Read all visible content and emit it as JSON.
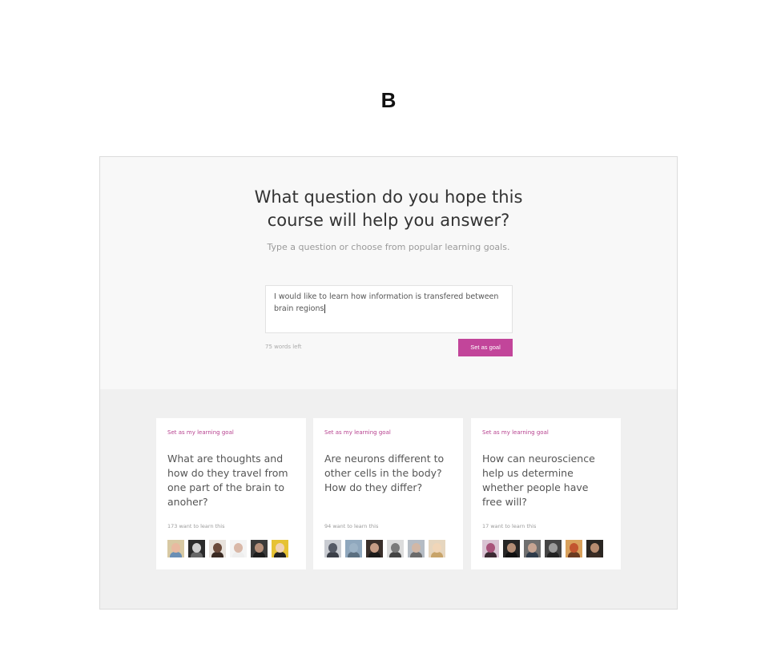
{
  "figure_label": "B",
  "page": {
    "title_lines": [
      "What question do you hope this",
      "course will help you answer?"
    ],
    "subtitle": "Type a question or choose from popular learning goals."
  },
  "goal_input": {
    "lines": [
      "I would like to learn how information is transfered between",
      "brain regions"
    ],
    "words_left": "75 words left",
    "button_label": "Set as goal"
  },
  "cards": [
    {
      "link_label": "Set as my learning goal",
      "question": "What are thoughts and how do they travel from one part of the brain to anoher?",
      "count_label": "173 want to learn this",
      "avatars": [
        {
          "bg": "#d8c9a3",
          "face": "#e9b9a0",
          "body": "#6a8fb5"
        },
        {
          "bg": "#2b2b2b",
          "face": "#cfcfcf",
          "body": "#666666"
        },
        {
          "bg": "#e8e2dc",
          "face": "#6b4a3a",
          "body": "#3a2a22"
        },
        {
          "bg": "#f4f4f4",
          "face": "#d9b8a8",
          "body": "#eeeeee"
        },
        {
          "bg": "#3a3a3a",
          "face": "#b58f7a",
          "body": "#1c1c1c"
        },
        {
          "bg": "#e6c234",
          "face": "#f0d3b5",
          "body": "#222222"
        }
      ]
    },
    {
      "link_label": "Set as my learning goal",
      "question": "Are neurons different  to other cells in the body? How do they differ?",
      "count_label": "94 want to learn this",
      "avatars": [
        {
          "bg": "#c9ccd2",
          "face": "#555a66",
          "body": "#3b3f48"
        },
        {
          "bg": "#8fa7bd",
          "face": "#9db3c6",
          "body": "#5b6f80"
        },
        {
          "bg": "#3a2f2a",
          "face": "#c79d86",
          "body": "#1a1a1a"
        },
        {
          "bg": "#dcdcdc",
          "face": "#7a7a7a",
          "body": "#444444"
        },
        {
          "bg": "#b5bcc4",
          "face": "#d2b7a5",
          "body": "#6b6b6b"
        },
        {
          "bg": "#e6d6bf",
          "face": "#f1d6b8",
          "body": "#c8a46a"
        }
      ]
    },
    {
      "link_label": "Set as my learning goal",
      "question": "How can neuroscience help us determine whether people have free will?",
      "count_label": "17 want to learn this",
      "avatars": [
        {
          "bg": "#d9c3d3",
          "face": "#a8527a",
          "body": "#3c2a33"
        },
        {
          "bg": "#262626",
          "face": "#b38d76",
          "body": "#111111"
        },
        {
          "bg": "#6f6f6f",
          "face": "#c7a593",
          "body": "#2e3b4a"
        },
        {
          "bg": "#444444",
          "face": "#9b9b9b",
          "body": "#222222"
        },
        {
          "bg": "#d9a15c",
          "face": "#c2542f",
          "body": "#6a3a20"
        },
        {
          "bg": "#2a2622",
          "face": "#b88c70",
          "body": "#3a2c24"
        }
      ]
    }
  ]
}
